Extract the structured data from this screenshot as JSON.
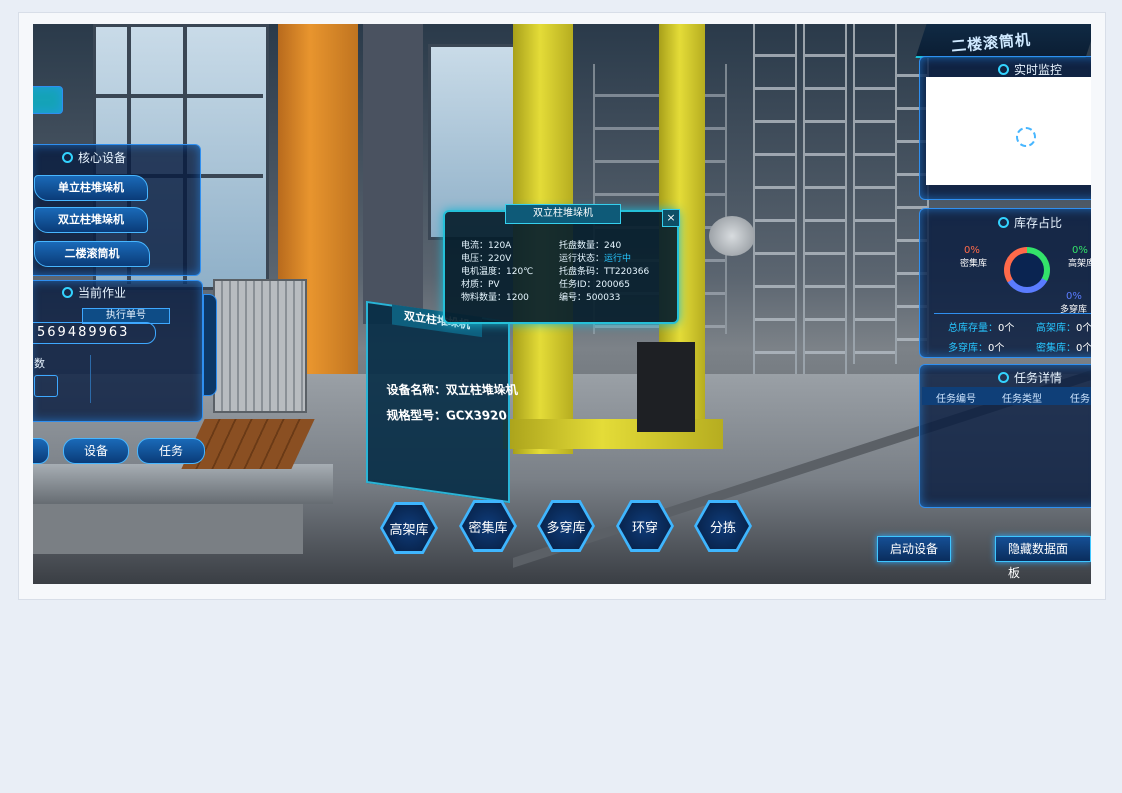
{
  "top_title": "二楼滚筒机",
  "left_panel": {
    "core_title": "核心设备",
    "devices": [
      "单立柱堆垛机",
      "双立柱堆垛机",
      "二楼滚筒机"
    ],
    "job_title": "当前作业",
    "order_label": "执行单号",
    "order_number": "569489963",
    "partial_label": "数",
    "bottom_tabs": [
      "设备",
      "任务"
    ]
  },
  "popup": {
    "title": "双立柱堆垛机",
    "close": "×",
    "left_rows": [
      "电流：120A",
      "电压：220V",
      "电机温度：120℃",
      "材质：PV",
      "物料数量：1200"
    ],
    "right_rows": [
      {
        "label": "托盘数量：",
        "value": "240"
      },
      {
        "label": "运行状态：",
        "value": "运行中"
      },
      {
        "label": "托盘条码：",
        "value": "TT220366"
      },
      {
        "label": "任务ID：",
        "value": "200065"
      },
      {
        "label": "编号：",
        "value": "500033"
      }
    ],
    "status_color": "#27c6ff"
  },
  "sign": {
    "title": "双立柱堆垛机",
    "name_line": "设备名称：双立柱堆垛机",
    "model_line": "规格型号：GCX3920"
  },
  "bottom_nav": [
    "高架库",
    "密集库",
    "多穿库",
    "环穿",
    "分拣"
  ],
  "right_panel": {
    "monitor_title": "实时监控",
    "stock_title": "库存占比",
    "stock_items": [
      {
        "pct": "0%",
        "name": "密集库",
        "color": "#ff6a4a"
      },
      {
        "pct": "0%",
        "name": "高架库",
        "color": "#33e36a"
      },
      {
        "pct": "0%",
        "name": "多穿库",
        "color": "#5a7cff"
      }
    ],
    "stats": [
      {
        "label": "总库存量：",
        "value": "0个"
      },
      {
        "label": "高架库：",
        "value": "0个"
      },
      {
        "label": "多穿库：",
        "value": "0个"
      },
      {
        "label": "密集库：",
        "value": "0个"
      }
    ],
    "task_title": "任务详情",
    "task_columns": [
      "任务编号",
      "任务类型",
      "任务"
    ]
  },
  "actions": {
    "start": "启动设备",
    "hide": "隐藏数据面板"
  }
}
